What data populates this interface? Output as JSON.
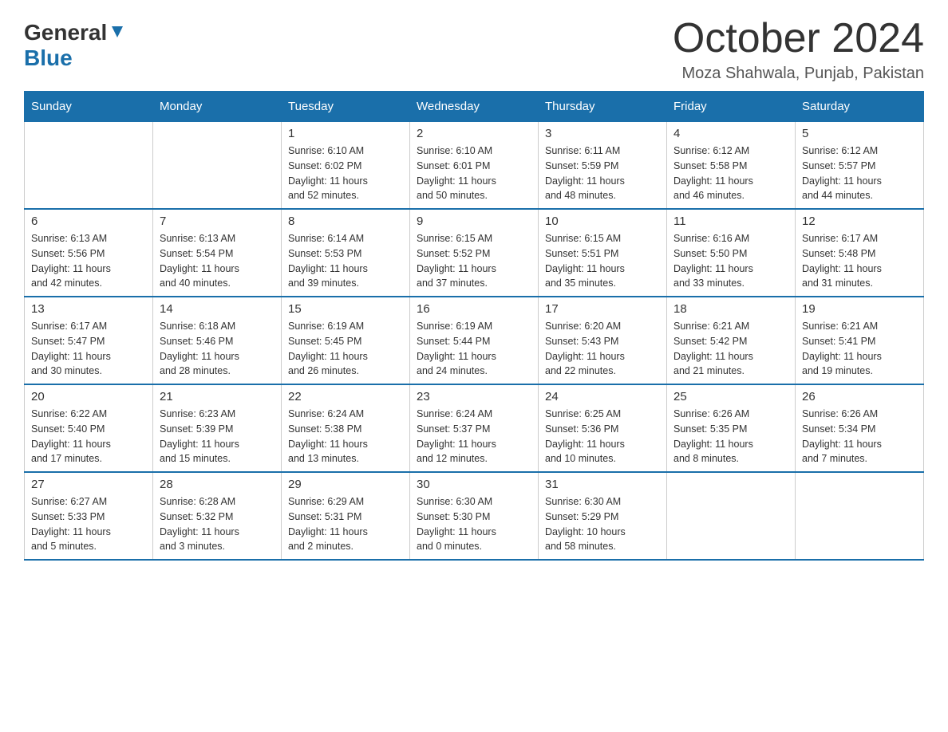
{
  "header": {
    "logo_line1": "General",
    "logo_line2": "Blue",
    "title": "October 2024",
    "subtitle": "Moza Shahwala, Punjab, Pakistan"
  },
  "days": [
    "Sunday",
    "Monday",
    "Tuesday",
    "Wednesday",
    "Thursday",
    "Friday",
    "Saturday"
  ],
  "weeks": [
    [
      {
        "day": "",
        "info": ""
      },
      {
        "day": "",
        "info": ""
      },
      {
        "day": "1",
        "info": "Sunrise: 6:10 AM\nSunset: 6:02 PM\nDaylight: 11 hours\nand 52 minutes."
      },
      {
        "day": "2",
        "info": "Sunrise: 6:10 AM\nSunset: 6:01 PM\nDaylight: 11 hours\nand 50 minutes."
      },
      {
        "day": "3",
        "info": "Sunrise: 6:11 AM\nSunset: 5:59 PM\nDaylight: 11 hours\nand 48 minutes."
      },
      {
        "day": "4",
        "info": "Sunrise: 6:12 AM\nSunset: 5:58 PM\nDaylight: 11 hours\nand 46 minutes."
      },
      {
        "day": "5",
        "info": "Sunrise: 6:12 AM\nSunset: 5:57 PM\nDaylight: 11 hours\nand 44 minutes."
      }
    ],
    [
      {
        "day": "6",
        "info": "Sunrise: 6:13 AM\nSunset: 5:56 PM\nDaylight: 11 hours\nand 42 minutes."
      },
      {
        "day": "7",
        "info": "Sunrise: 6:13 AM\nSunset: 5:54 PM\nDaylight: 11 hours\nand 40 minutes."
      },
      {
        "day": "8",
        "info": "Sunrise: 6:14 AM\nSunset: 5:53 PM\nDaylight: 11 hours\nand 39 minutes."
      },
      {
        "day": "9",
        "info": "Sunrise: 6:15 AM\nSunset: 5:52 PM\nDaylight: 11 hours\nand 37 minutes."
      },
      {
        "day": "10",
        "info": "Sunrise: 6:15 AM\nSunset: 5:51 PM\nDaylight: 11 hours\nand 35 minutes."
      },
      {
        "day": "11",
        "info": "Sunrise: 6:16 AM\nSunset: 5:50 PM\nDaylight: 11 hours\nand 33 minutes."
      },
      {
        "day": "12",
        "info": "Sunrise: 6:17 AM\nSunset: 5:48 PM\nDaylight: 11 hours\nand 31 minutes."
      }
    ],
    [
      {
        "day": "13",
        "info": "Sunrise: 6:17 AM\nSunset: 5:47 PM\nDaylight: 11 hours\nand 30 minutes."
      },
      {
        "day": "14",
        "info": "Sunrise: 6:18 AM\nSunset: 5:46 PM\nDaylight: 11 hours\nand 28 minutes."
      },
      {
        "day": "15",
        "info": "Sunrise: 6:19 AM\nSunset: 5:45 PM\nDaylight: 11 hours\nand 26 minutes."
      },
      {
        "day": "16",
        "info": "Sunrise: 6:19 AM\nSunset: 5:44 PM\nDaylight: 11 hours\nand 24 minutes."
      },
      {
        "day": "17",
        "info": "Sunrise: 6:20 AM\nSunset: 5:43 PM\nDaylight: 11 hours\nand 22 minutes."
      },
      {
        "day": "18",
        "info": "Sunrise: 6:21 AM\nSunset: 5:42 PM\nDaylight: 11 hours\nand 21 minutes."
      },
      {
        "day": "19",
        "info": "Sunrise: 6:21 AM\nSunset: 5:41 PM\nDaylight: 11 hours\nand 19 minutes."
      }
    ],
    [
      {
        "day": "20",
        "info": "Sunrise: 6:22 AM\nSunset: 5:40 PM\nDaylight: 11 hours\nand 17 minutes."
      },
      {
        "day": "21",
        "info": "Sunrise: 6:23 AM\nSunset: 5:39 PM\nDaylight: 11 hours\nand 15 minutes."
      },
      {
        "day": "22",
        "info": "Sunrise: 6:24 AM\nSunset: 5:38 PM\nDaylight: 11 hours\nand 13 minutes."
      },
      {
        "day": "23",
        "info": "Sunrise: 6:24 AM\nSunset: 5:37 PM\nDaylight: 11 hours\nand 12 minutes."
      },
      {
        "day": "24",
        "info": "Sunrise: 6:25 AM\nSunset: 5:36 PM\nDaylight: 11 hours\nand 10 minutes."
      },
      {
        "day": "25",
        "info": "Sunrise: 6:26 AM\nSunset: 5:35 PM\nDaylight: 11 hours\nand 8 minutes."
      },
      {
        "day": "26",
        "info": "Sunrise: 6:26 AM\nSunset: 5:34 PM\nDaylight: 11 hours\nand 7 minutes."
      }
    ],
    [
      {
        "day": "27",
        "info": "Sunrise: 6:27 AM\nSunset: 5:33 PM\nDaylight: 11 hours\nand 5 minutes."
      },
      {
        "day": "28",
        "info": "Sunrise: 6:28 AM\nSunset: 5:32 PM\nDaylight: 11 hours\nand 3 minutes."
      },
      {
        "day": "29",
        "info": "Sunrise: 6:29 AM\nSunset: 5:31 PM\nDaylight: 11 hours\nand 2 minutes."
      },
      {
        "day": "30",
        "info": "Sunrise: 6:30 AM\nSunset: 5:30 PM\nDaylight: 11 hours\nand 0 minutes."
      },
      {
        "day": "31",
        "info": "Sunrise: 6:30 AM\nSunset: 5:29 PM\nDaylight: 10 hours\nand 58 minutes."
      },
      {
        "day": "",
        "info": ""
      },
      {
        "day": "",
        "info": ""
      }
    ]
  ]
}
